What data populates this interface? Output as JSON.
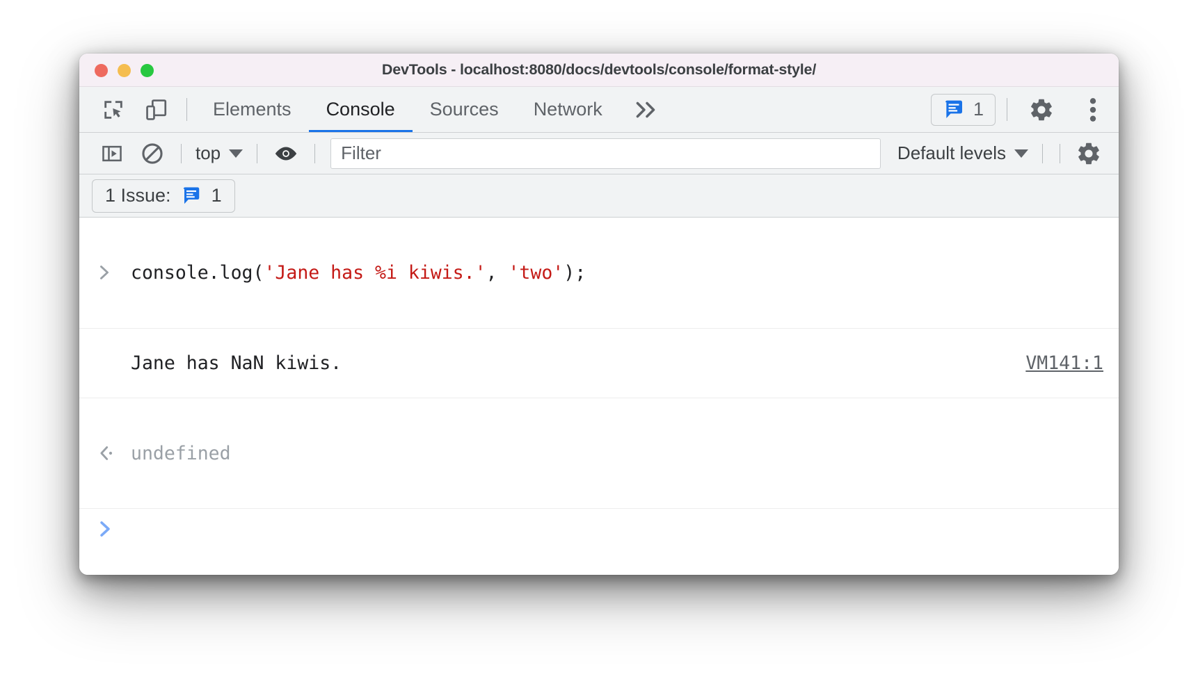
{
  "window": {
    "title": "DevTools - localhost:8080/docs/devtools/console/format-style/",
    "traffic_lights": [
      "close",
      "minimize",
      "maximize"
    ],
    "colors": {
      "titlebar_bg": "#f6eff5",
      "toolbar_bg": "#f1f3f4",
      "accent_blue": "#1a73e8",
      "string_red": "#c41a16",
      "muted_gray": "#9aa0a6",
      "prompt_blue": "#7baaf7"
    }
  },
  "tabbar": {
    "inspect_icon": "inspect-element-icon",
    "device_icon": "device-toolbar-icon",
    "tabs": [
      {
        "label": "Elements",
        "active": false
      },
      {
        "label": "Console",
        "active": true
      },
      {
        "label": "Sources",
        "active": false
      },
      {
        "label": "Network",
        "active": false
      }
    ],
    "more_tabs_icon": "chevron-double-right-icon",
    "issues": {
      "icon": "issues-bubble-icon",
      "count": "1"
    },
    "settings_icon": "gear-icon",
    "more_options_icon": "kebab-menu-icon"
  },
  "console_toolbar": {
    "sidebar_toggle_icon": "console-sidebar-icon",
    "clear_console_icon": "clear-console-icon",
    "context_selector": {
      "value": "top",
      "caret": "chevron-down-icon"
    },
    "live_expression_icon": "eye-icon",
    "filter": {
      "value": "",
      "placeholder": "Filter"
    },
    "levels_selector": {
      "value": "Default levels",
      "caret": "chevron-down-icon"
    },
    "settings_icon": "gear-icon"
  },
  "issues_banner": {
    "label": "1 Issue:",
    "icon": "issues-bubble-icon",
    "count": "1"
  },
  "console": {
    "rows": [
      {
        "type": "input",
        "gutter_icon": "input-chevron-icon",
        "tokens": [
          {
            "text": "console.log(",
            "kind": "plain"
          },
          {
            "text": "'Jane has %i kiwis.'",
            "kind": "string"
          },
          {
            "text": ", ",
            "kind": "plain"
          },
          {
            "text": "'two'",
            "kind": "string"
          },
          {
            "text": ");",
            "kind": "plain"
          }
        ],
        "source": ""
      },
      {
        "type": "output",
        "gutter_icon": "",
        "tokens": [
          {
            "text": "Jane has NaN kiwis.",
            "kind": "plain"
          }
        ],
        "source": "VM141:1"
      },
      {
        "type": "return",
        "gutter_icon": "return-arrow-icon",
        "tokens": [
          {
            "text": "undefined",
            "kind": "muted"
          }
        ],
        "source": ""
      }
    ],
    "prompt": {
      "icon": "prompt-chevron-icon",
      "value": ""
    }
  }
}
